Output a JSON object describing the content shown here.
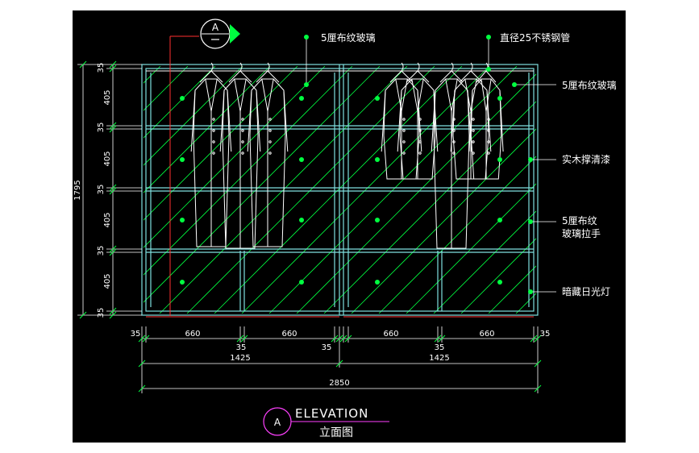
{
  "drawing": {
    "section_tag": "A",
    "title_en": "ELEVATION",
    "title_cn": "立面图",
    "title_tag": "A"
  },
  "annotations": {
    "top_left": "5厘布纹玻璃",
    "top_right": "直径25不锈钢管",
    "right_1": "5厘布纹玻璃",
    "right_2": "实木撑清漆",
    "right_3a": "5厘布纹",
    "right_3b": "玻璃拉手",
    "right_4": "暗藏日光灯"
  },
  "dimensions": {
    "vertical_total": "1795",
    "vertical": [
      "35",
      "405",
      "35",
      "405",
      "35",
      "405",
      "35",
      "405",
      "35"
    ],
    "bottom_row1": [
      "35",
      "660",
      "660",
      "660",
      "660",
      "35"
    ],
    "bottom_row2_35": [
      "35",
      "35",
      "35"
    ],
    "bottom_row2_half": [
      "1425",
      "1425"
    ],
    "bottom_total": "2850"
  },
  "colors": {
    "background": "#000000",
    "line_cyan": "#7fe0e0",
    "line_white": "#ffffff",
    "line_green": "#00ff40",
    "line_red": "#ff3030",
    "magenta": "#ff40ff"
  }
}
